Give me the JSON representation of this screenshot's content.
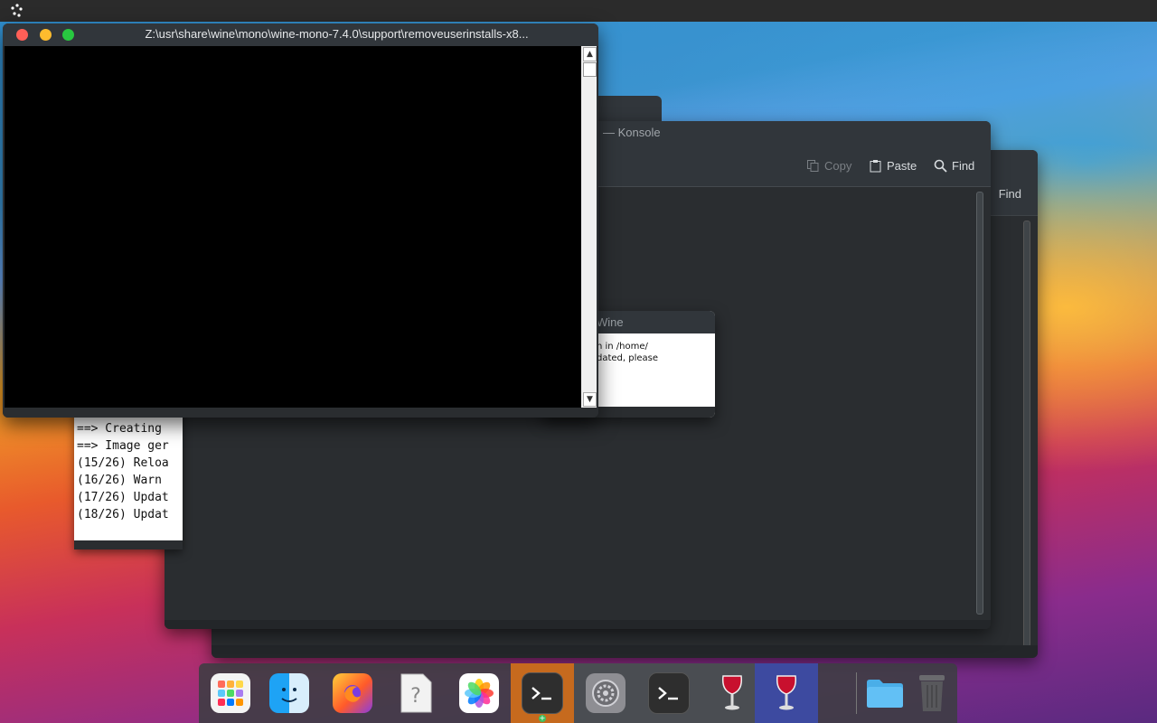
{
  "console_window": {
    "title": "Z:\\usr\\share\\wine\\mono\\wine-mono-7.4.0\\support\\removeuserinstalls-x8..."
  },
  "konsole_window": {
    "title": "— Konsole",
    "toolbar": {
      "copy_label": "Copy",
      "paste_label": "Paste",
      "find_label": "Find"
    }
  },
  "konsole_back_window": {
    "find_label": "Find"
  },
  "wine_dialog": {
    "title": "Wine",
    "message_line1": "n in /home/",
    "message_line2": "dated, please"
  },
  "terminal_output": {
    "lines": [
      "==> Creating",
      "==> Image ger",
      "(15/26) Reloa",
      "(16/26) Warn",
      "(17/26) Updat",
      "(18/26) Updat"
    ]
  },
  "dock": {
    "items": [
      {
        "name": "launchpad-icon"
      },
      {
        "name": "finder-icon"
      },
      {
        "name": "firefox-icon"
      },
      {
        "name": "unknown-file-icon"
      },
      {
        "name": "photos-icon"
      },
      {
        "name": "terminal-icon"
      },
      {
        "name": "system-settings-icon"
      },
      {
        "name": "terminal-icon"
      },
      {
        "name": "wine-icon"
      },
      {
        "name": "wine-icon"
      },
      {
        "name": "folder-icon"
      },
      {
        "name": "trash-icon"
      }
    ]
  }
}
